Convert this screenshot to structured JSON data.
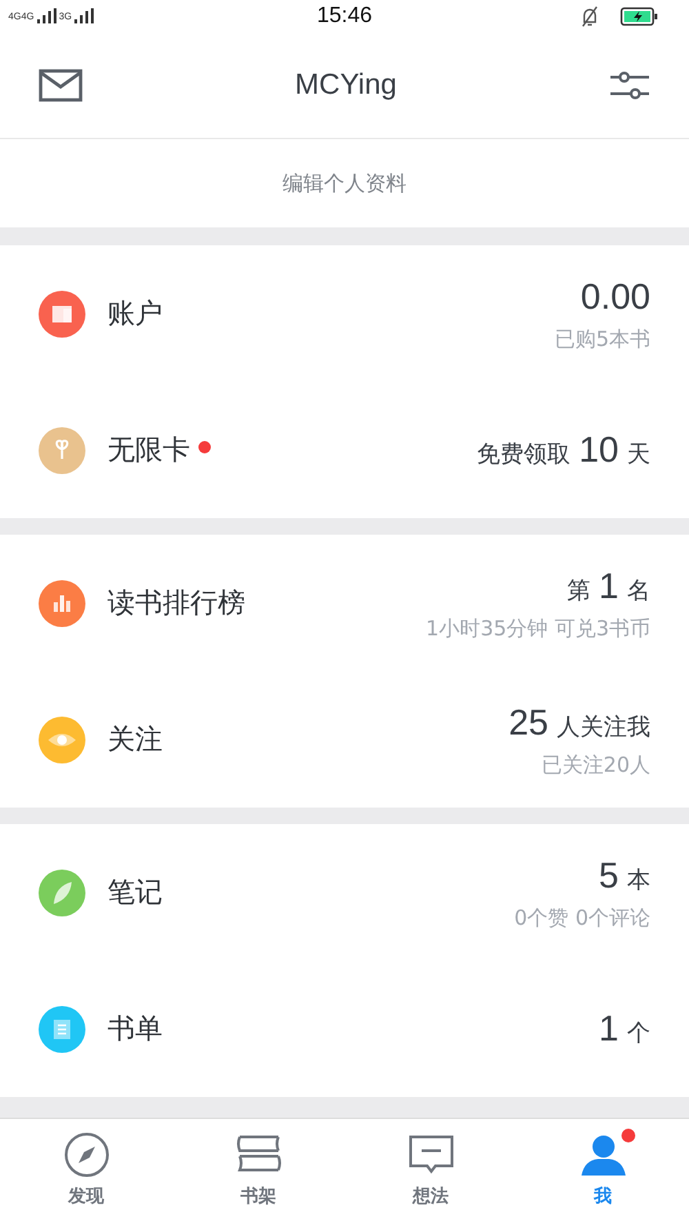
{
  "status_bar": {
    "network_1": "4G4G",
    "network_2": "3G",
    "time": "15:46"
  },
  "header": {
    "title": "MCYing"
  },
  "edit_profile": "编辑个人资料",
  "sections": [
    {
      "rows": [
        {
          "label": "账户",
          "badge": false,
          "color": "#f9624f",
          "prefix": "",
          "number": "0.00",
          "suffix": "",
          "sub": "已购5本书"
        },
        {
          "label": "无限卡",
          "badge": true,
          "color": "#e9c28e",
          "prefix": "免费领取",
          "number": "10",
          "suffix": "天",
          "sub": ""
        }
      ]
    },
    {
      "rows": [
        {
          "label": "读书排行榜",
          "badge": false,
          "color": "#fb7d45",
          "prefix": "第",
          "number": "1",
          "suffix": "名",
          "sub": "1小时35分钟 可兑3书币"
        },
        {
          "label": "关注",
          "badge": false,
          "color": "#fdbb31",
          "prefix": "",
          "number": "25",
          "suffix": "人关注我",
          "sub": "已关注20人"
        }
      ]
    },
    {
      "rows": [
        {
          "label": "笔记",
          "badge": false,
          "color": "#7bcd5c",
          "prefix": "",
          "number": "5",
          "suffix": "本",
          "sub": "0个赞 0个评论"
        },
        {
          "label": "书单",
          "badge": false,
          "color": "#20c6f5",
          "prefix": "",
          "number": "1",
          "suffix": "个",
          "sub": ""
        }
      ]
    }
  ],
  "tabs": [
    {
      "label": "发现",
      "selected": false,
      "badge": false
    },
    {
      "label": "书架",
      "selected": false,
      "badge": false
    },
    {
      "label": "想法",
      "selected": false,
      "badge": false
    },
    {
      "label": "我",
      "selected": true,
      "badge": true
    }
  ]
}
